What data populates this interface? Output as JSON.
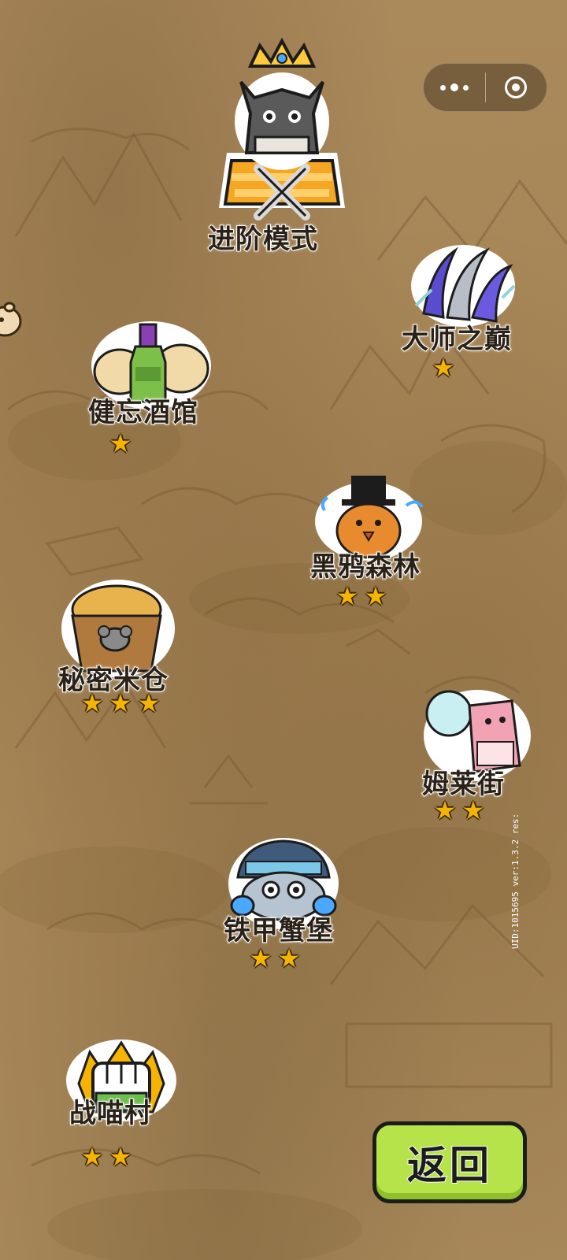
{
  "capsule": {
    "more_icon": "more-dots-icon",
    "close_icon": "target-close-icon"
  },
  "levels": [
    {
      "name": "进阶模式",
      "stars": 0,
      "icon": "crowned-cat-icon"
    },
    {
      "name": "大师之巅",
      "stars": 1,
      "icon": "claw-slash-icon"
    },
    {
      "name": "健忘酒馆",
      "stars": 1,
      "icon": "bottle-icon"
    },
    {
      "name": "黑鸦森林",
      "stars": 2,
      "icon": "top-hat-bird-icon"
    },
    {
      "name": "秘密米仓",
      "stars": 3,
      "icon": "rice-basket-icon"
    },
    {
      "name": "姆莱街",
      "stars": 2,
      "icon": "pink-box-icon"
    },
    {
      "name": "铁甲蟹堡",
      "stars": 2,
      "icon": "armored-crab-icon"
    },
    {
      "name": "战喵村",
      "stars": 2,
      "icon": "fist-icon"
    }
  ],
  "star_glyph": "★",
  "back_button": {
    "label": "返回"
  },
  "uid_text": "UID:1015695 ver:1.3.2 res:"
}
